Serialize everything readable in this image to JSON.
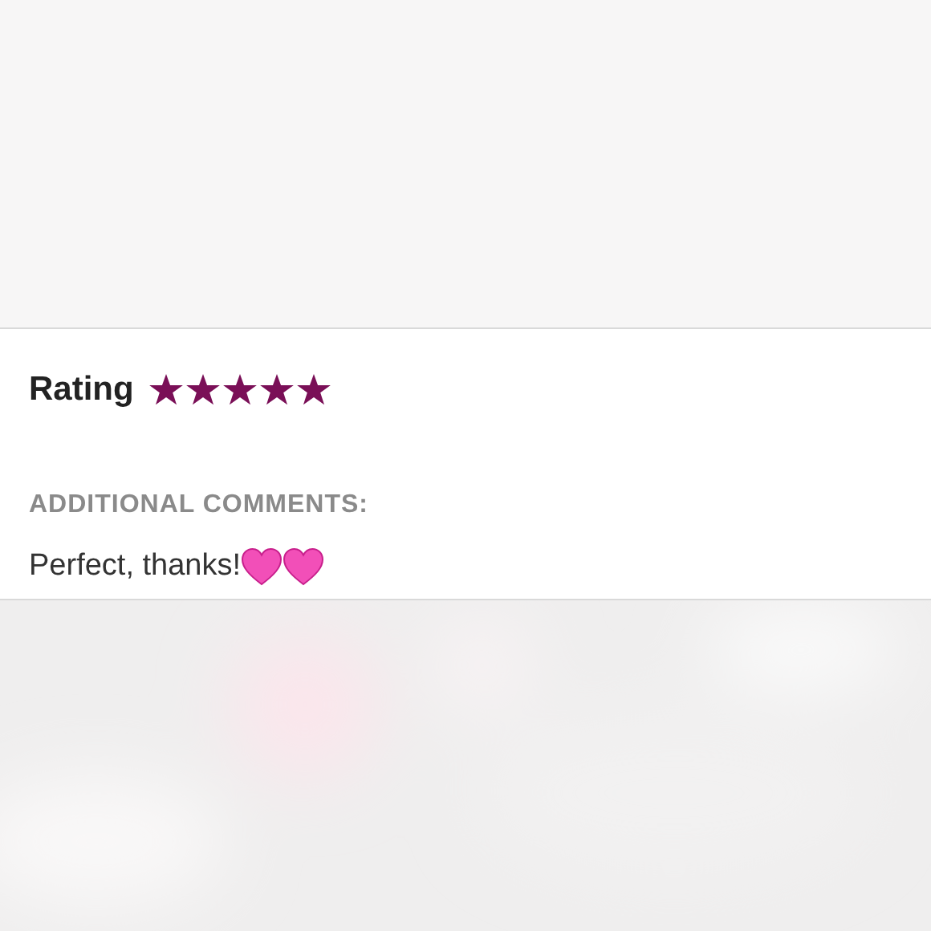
{
  "rating": {
    "label": "Rating",
    "stars": 5
  },
  "comments": {
    "label": "ADDITIONAL COMMENTS:",
    "text": "Perfect, thanks!"
  }
}
